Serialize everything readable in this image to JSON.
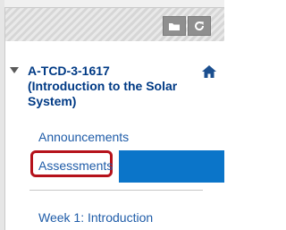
{
  "toolbar": {
    "folder_icon": "folder-icon",
    "refresh_icon": "refresh-icon"
  },
  "course": {
    "title_line1": "A-TCD-3-1617",
    "title_line2": "(Introduction to the Solar",
    "title_line3": "System)",
    "expanded": true
  },
  "menu": {
    "announcements": "Announcements",
    "assessments": "Assessments",
    "week1": "Week 1: Introduction"
  },
  "colors": {
    "link": "#1f5ca8",
    "title": "#003a85",
    "highlight": "#b5121b",
    "accent_bar": "#0b75c9"
  }
}
